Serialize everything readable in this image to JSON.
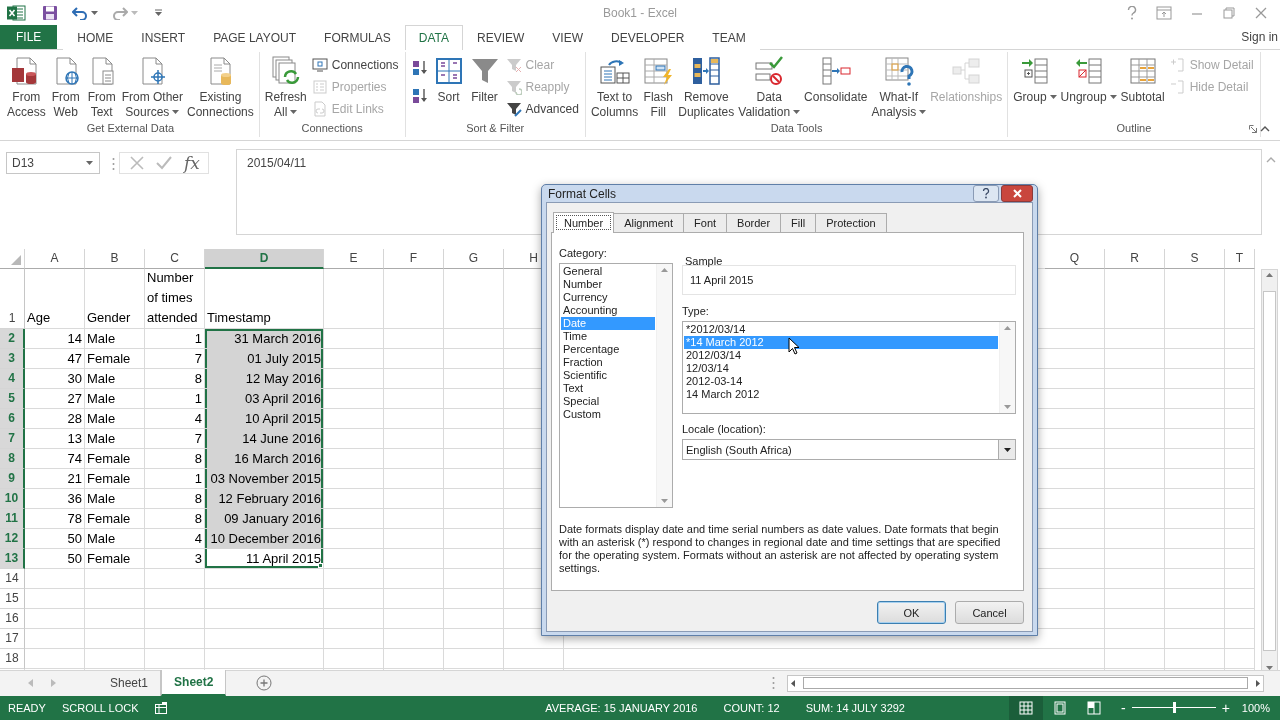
{
  "window": {
    "title": "Book1 - Excel"
  },
  "ribbon_tabs": [
    {
      "label": "FILE",
      "kind": "file",
      "selected": false
    },
    {
      "label": "HOME",
      "kind": "tab",
      "selected": false
    },
    {
      "label": "INSERT",
      "kind": "tab",
      "selected": false
    },
    {
      "label": "PAGE LAYOUT",
      "kind": "tab",
      "selected": false
    },
    {
      "label": "FORMULAS",
      "kind": "tab",
      "selected": false
    },
    {
      "label": "DATA",
      "kind": "tab",
      "selected": true
    },
    {
      "label": "REVIEW",
      "kind": "tab",
      "selected": false
    },
    {
      "label": "VIEW",
      "kind": "tab",
      "selected": false
    },
    {
      "label": "DEVELOPER",
      "kind": "tab",
      "selected": false
    },
    {
      "label": "TEAM",
      "kind": "tab",
      "selected": false
    }
  ],
  "account": {
    "label": "Sign in"
  },
  "ribbon": {
    "groups": [
      {
        "label": "Get External Data",
        "items": [
          {
            "kind": "large",
            "label": "From\nAccess",
            "dropdown": false,
            "disabled": false
          },
          {
            "kind": "large",
            "label": "From\nWeb",
            "dropdown": false,
            "disabled": false
          },
          {
            "kind": "large",
            "label": "From\nText",
            "dropdown": false,
            "disabled": false
          },
          {
            "kind": "large",
            "label": "From Other\nSources",
            "dropdown": true,
            "disabled": false
          },
          {
            "kind": "large",
            "label": "Existing\nConnections",
            "dropdown": false,
            "disabled": false
          }
        ]
      },
      {
        "label": "Connections",
        "items": [
          {
            "kind": "large",
            "label": "Refresh\nAll",
            "dropdown": true,
            "disabled": false
          },
          {
            "kind": "stack",
            "items": [
              {
                "kind": "small",
                "label": "Connections",
                "disabled": false
              },
              {
                "kind": "small",
                "label": "Properties",
                "disabled": true
              },
              {
                "kind": "small",
                "label": "Edit Links",
                "disabled": true
              }
            ]
          }
        ]
      },
      {
        "label": "Sort & Filter",
        "items": [
          {
            "kind": "stack",
            "items": [
              {
                "kind": "icon",
                "disabled": false
              },
              {
                "kind": "icon",
                "disabled": false
              }
            ]
          },
          {
            "kind": "large",
            "label": "Sort",
            "dropdown": false,
            "disabled": false
          },
          {
            "kind": "large",
            "label": "Filter",
            "dropdown": false,
            "disabled": false
          },
          {
            "kind": "stack",
            "items": [
              {
                "kind": "small",
                "label": "Clear",
                "disabled": true
              },
              {
                "kind": "small",
                "label": "Reapply",
                "disabled": true
              },
              {
                "kind": "small",
                "label": "Advanced",
                "disabled": false
              }
            ]
          }
        ]
      },
      {
        "label": "Data Tools",
        "items": [
          {
            "kind": "large",
            "label": "Text to\nColumns",
            "dropdown": false,
            "disabled": false
          },
          {
            "kind": "large",
            "label": "Flash\nFill",
            "dropdown": false,
            "disabled": false
          },
          {
            "kind": "large",
            "label": "Remove\nDuplicates",
            "dropdown": false,
            "disabled": false
          },
          {
            "kind": "large",
            "label": "Data\nValidation",
            "dropdown": true,
            "disabled": false
          },
          {
            "kind": "large",
            "label": "Consolidate",
            "dropdown": false,
            "disabled": false
          },
          {
            "kind": "large",
            "label": "What-If\nAnalysis",
            "dropdown": true,
            "disabled": false
          },
          {
            "kind": "large",
            "label": "Relationships",
            "dropdown": false,
            "disabled": true
          }
        ]
      },
      {
        "label": "Outline",
        "launcher": true,
        "items": [
          {
            "kind": "large",
            "label": "Group",
            "dropdown": true,
            "disabled": false
          },
          {
            "kind": "large",
            "label": "Ungroup",
            "dropdown": true,
            "disabled": false
          },
          {
            "kind": "large",
            "label": "Subtotal",
            "dropdown": false,
            "disabled": false
          },
          {
            "kind": "stack",
            "items": [
              {
                "kind": "small",
                "label": "Show Detail",
                "disabled": true
              },
              {
                "kind": "small",
                "label": "Hide Detail",
                "disabled": true
              }
            ]
          }
        ]
      }
    ]
  },
  "formula_bar": {
    "name_box": "D13",
    "fx": "fx",
    "value": "2015/04/11"
  },
  "sheet": {
    "columns": [
      {
        "label": "A",
        "selected": false,
        "kind": "number"
      },
      {
        "label": "B",
        "selected": false,
        "kind": "text"
      },
      {
        "label": "C",
        "selected": false,
        "kind": "number"
      },
      {
        "label": "D",
        "selected": true,
        "kind": "date"
      },
      {
        "label": "E",
        "selected": false,
        "kind": "blank"
      },
      {
        "label": "F",
        "selected": false,
        "kind": "blank"
      },
      {
        "label": "G",
        "selected": false,
        "kind": "blank"
      },
      {
        "label": "H",
        "selected": false,
        "kind": "blank"
      }
    ],
    "columns_right": [
      {
        "label": "Q",
        "selected": false
      },
      {
        "label": "R",
        "selected": false
      },
      {
        "label": "S",
        "selected": false
      },
      {
        "label": "T",
        "selected": false
      }
    ],
    "rows": [
      {
        "label": "1",
        "kind": "header",
        "selected": false,
        "cells": [
          "Age",
          "Gender",
          "Number of times attended",
          "Timestamp"
        ]
      },
      {
        "label": "2",
        "kind": "data",
        "selected": true,
        "cells": [
          "14",
          "Male",
          "1",
          "31 March 2016"
        ]
      },
      {
        "label": "3",
        "kind": "data",
        "selected": true,
        "cells": [
          "47",
          "Female",
          "7",
          "01 July 2015"
        ]
      },
      {
        "label": "4",
        "kind": "data",
        "selected": true,
        "cells": [
          "30",
          "Male",
          "8",
          "12 May 2016"
        ]
      },
      {
        "label": "5",
        "kind": "data",
        "selected": true,
        "cells": [
          "27",
          "Male",
          "1",
          "03 April 2016"
        ]
      },
      {
        "label": "6",
        "kind": "data",
        "selected": true,
        "cells": [
          "28",
          "Male",
          "4",
          "10 April 2015"
        ]
      },
      {
        "label": "7",
        "kind": "data",
        "selected": true,
        "cells": [
          "13",
          "Male",
          "7",
          "14 June 2016"
        ]
      },
      {
        "label": "8",
        "kind": "data",
        "selected": true,
        "cells": [
          "74",
          "Female",
          "8",
          "16 March 2016"
        ]
      },
      {
        "label": "9",
        "kind": "data",
        "selected": true,
        "cells": [
          "21",
          "Female",
          "1",
          "03 November 2015"
        ]
      },
      {
        "label": "10",
        "kind": "data",
        "selected": true,
        "cells": [
          "36",
          "Male",
          "8",
          "12 February 2016"
        ]
      },
      {
        "label": "11",
        "kind": "data",
        "selected": true,
        "cells": [
          "78",
          "Female",
          "8",
          "09 January 2016"
        ]
      },
      {
        "label": "12",
        "kind": "data",
        "selected": true,
        "cells": [
          "50",
          "Male",
          "4",
          "10 December 2016"
        ]
      },
      {
        "label": "13",
        "kind": "data",
        "selected": true,
        "active": true,
        "cells": [
          "50",
          "Female",
          "3",
          "11 April 2015"
        ]
      },
      {
        "label": "14",
        "kind": "data",
        "selected": false
      },
      {
        "label": "15",
        "kind": "data",
        "selected": false
      },
      {
        "label": "16",
        "kind": "data",
        "selected": false
      },
      {
        "label": "17",
        "kind": "data",
        "selected": false
      },
      {
        "label": "18",
        "kind": "data",
        "selected": false
      }
    ]
  },
  "sheet_tabs": [
    {
      "label": "Sheet1",
      "selected": false
    },
    {
      "label": "Sheet2",
      "selected": true
    }
  ],
  "status_bar": {
    "mode": "READY",
    "scroll_lock": "SCROLL LOCK",
    "average": "AVERAGE: 15 JANUARY 2016",
    "count": "COUNT: 12",
    "sum": "SUM: 14 JULY 3292",
    "views": [
      {
        "kind": "normal",
        "selected": true
      },
      {
        "kind": "page-layout",
        "selected": false
      },
      {
        "kind": "page-break",
        "selected": false
      }
    ],
    "zoom": {
      "minus": "-",
      "plus": "+",
      "level": 0.5,
      "reading": "100%"
    }
  },
  "dialog": {
    "title": "Format Cells",
    "tabs": [
      {
        "label": "Number",
        "selected": true
      },
      {
        "label": "Alignment",
        "selected": false
      },
      {
        "label": "Font",
        "selected": false
      },
      {
        "label": "Border",
        "selected": false
      },
      {
        "label": "Fill",
        "selected": false
      },
      {
        "label": "Protection",
        "selected": false
      }
    ],
    "category_label": "Category:",
    "categories": [
      {
        "label": "General",
        "selected": false
      },
      {
        "label": "Number",
        "selected": false
      },
      {
        "label": "Currency",
        "selected": false
      },
      {
        "label": "Accounting",
        "selected": false
      },
      {
        "label": "Date",
        "selected": true
      },
      {
        "label": "Time",
        "selected": false
      },
      {
        "label": "Percentage",
        "selected": false
      },
      {
        "label": "Fraction",
        "selected": false
      },
      {
        "label": "Scientific",
        "selected": false
      },
      {
        "label": "Text",
        "selected": false
      },
      {
        "label": "Special",
        "selected": false
      },
      {
        "label": "Custom",
        "selected": false
      }
    ],
    "sample_label": "Sample",
    "sample_value": "11 April 2015",
    "type_label": "Type:",
    "types": [
      {
        "label": "*2012/03/14",
        "selected": false
      },
      {
        "label": "*14 March 2012",
        "selected": true
      },
      {
        "label": "2012/03/14",
        "selected": false
      },
      {
        "label": "12/03/14",
        "selected": false
      },
      {
        "label": "2012-03-14",
        "selected": false
      },
      {
        "label": "14 March 2012",
        "selected": false
      }
    ],
    "locale_label": "Locale (location):",
    "locale_value": "English (South Africa)",
    "description": "Date formats display date and time serial numbers as date values. Date formats that begin with an asterisk (*) respond to changes in regional date and time settings that are specified for the operating system. Formats without an asterisk are not affected by operating system settings.",
    "buttons": [
      {
        "label": "OK",
        "kind": "default"
      },
      {
        "label": "Cancel",
        "kind": "normal"
      }
    ]
  }
}
